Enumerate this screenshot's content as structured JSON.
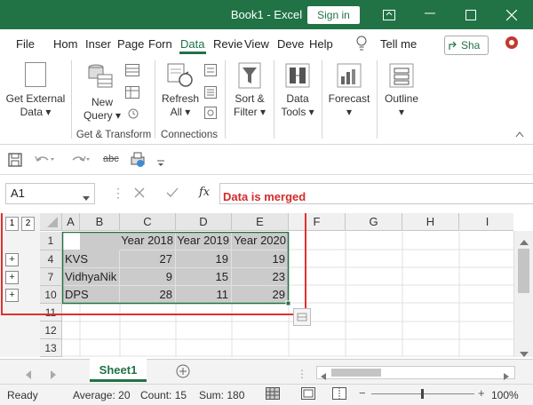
{
  "window": {
    "title": "Book1 - Excel",
    "sign_in": "Sign in"
  },
  "tabs": [
    "File",
    "Hom",
    "Inser",
    "Page",
    "Forn",
    "Data",
    "Revie",
    "View",
    "Deve",
    "Help"
  ],
  "tell_me": "Tell me",
  "share": "Sha",
  "ribbon": {
    "get_external_data": [
      "Get External",
      "Data ▾"
    ],
    "new_query": [
      "New",
      "Query ▾"
    ],
    "refresh_all": [
      "Refresh",
      "All ▾"
    ],
    "sort_filter": [
      "Sort &",
      "Filter ▾"
    ],
    "data_tools": [
      "Data",
      "Tools ▾"
    ],
    "forecast": [
      "Forecast",
      "▾"
    ],
    "outline": [
      "Outline",
      "▾"
    ],
    "group_get_transform": "Get & Transform",
    "group_connections": "Connections"
  },
  "qat": {
    "abc": "abc"
  },
  "namebox": "A1",
  "fx": "fx",
  "annotation": "Data is merged",
  "outline_levels": [
    "1",
    "2"
  ],
  "columns": [
    "A",
    "B",
    "C",
    "D",
    "E",
    "F",
    "G",
    "H",
    "I"
  ],
  "rows": [
    "1",
    "4",
    "7",
    "10",
    "11",
    "12",
    "13"
  ],
  "table": {
    "header": [
      "",
      "Year 2018",
      "Year 2019",
      "Year 2020"
    ],
    "rows": [
      {
        "name": "KVS",
        "v": [
          "27",
          "19",
          "19"
        ]
      },
      {
        "name": "VidhyaNik",
        "v": [
          "9",
          "15",
          "23"
        ]
      },
      {
        "name": "DPS",
        "v": [
          "28",
          "11",
          "29"
        ]
      }
    ]
  },
  "sheet": "Sheet1",
  "status": {
    "ready": "Ready",
    "average": "Average: 20",
    "count": "Count: 15",
    "sum": "Sum: 180",
    "zoom": "100%"
  },
  "colors": {
    "accent": "#217346",
    "annotation": "#d42a2a"
  }
}
